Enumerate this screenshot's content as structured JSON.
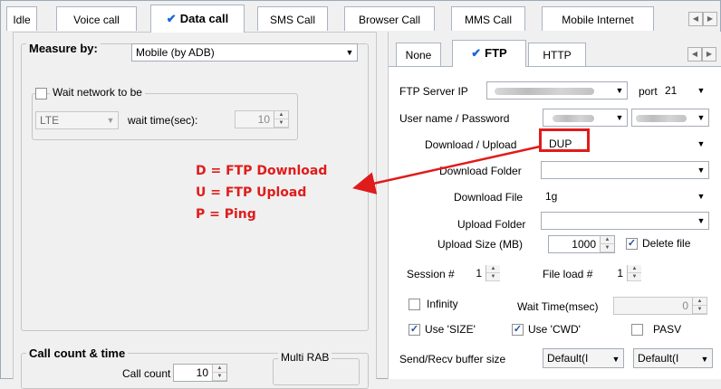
{
  "top_tabs": [
    {
      "label": "Idle"
    },
    {
      "label": "Voice call"
    },
    {
      "label": "Data call"
    },
    {
      "label": "SMS Call"
    },
    {
      "label": "Browser Call"
    },
    {
      "label": "MMS Call"
    },
    {
      "label": "Mobile Internet"
    }
  ],
  "left": {
    "measure_by_label": "Measure by:",
    "measure_by_value": "Mobile (by ADB)",
    "wait_network_label": "Wait network to be",
    "network_value": "LTE",
    "wait_time_label": "wait time(sec):",
    "wait_time_value": "10",
    "call_count_group": "Call count & time",
    "call_count_label": "Call count",
    "call_count_value": "10",
    "multi_rab_label": "Multi RAB"
  },
  "annotation": {
    "line1": "D = FTP Download",
    "line2": "U = FTP Upload",
    "line3": "P = Ping",
    "color": "#e01b1b"
  },
  "sub_tabs": [
    {
      "label": "None"
    },
    {
      "label": "FTP"
    },
    {
      "label": "HTTP"
    }
  ],
  "ftp": {
    "server_ip_label": "FTP Server IP",
    "port_label": "port",
    "port_value": "21",
    "user_pass_label": "User name / Password",
    "download_upload_label": "Download / Upload",
    "download_upload_value": "DUP",
    "download_folder_label": "Download Folder",
    "download_folder_value": "",
    "download_file_label": "Download File",
    "download_file_value": "1g",
    "upload_folder_label": "Upload Folder",
    "upload_folder_value": "",
    "upload_size_label": "Upload Size (MB)",
    "upload_size_value": "1000",
    "delete_file_label": "Delete file",
    "session_label": "Session #",
    "session_value": "1",
    "file_load_label": "File load #",
    "file_load_value": "1",
    "infinity_label": "Infinity",
    "wait_time_label": "Wait Time(msec)",
    "wait_time_value": "0",
    "use_size_label": "Use 'SIZE'",
    "use_cwd_label": "Use 'CWD'",
    "pasv_label": "PASV",
    "buffer_label": "Send/Recv buffer size",
    "buffer_send_value": "Default(I",
    "buffer_recv_value": "Default(I"
  },
  "colors": {
    "accent_check": "#1a66d9",
    "highlight_box": "#e01b1b"
  }
}
